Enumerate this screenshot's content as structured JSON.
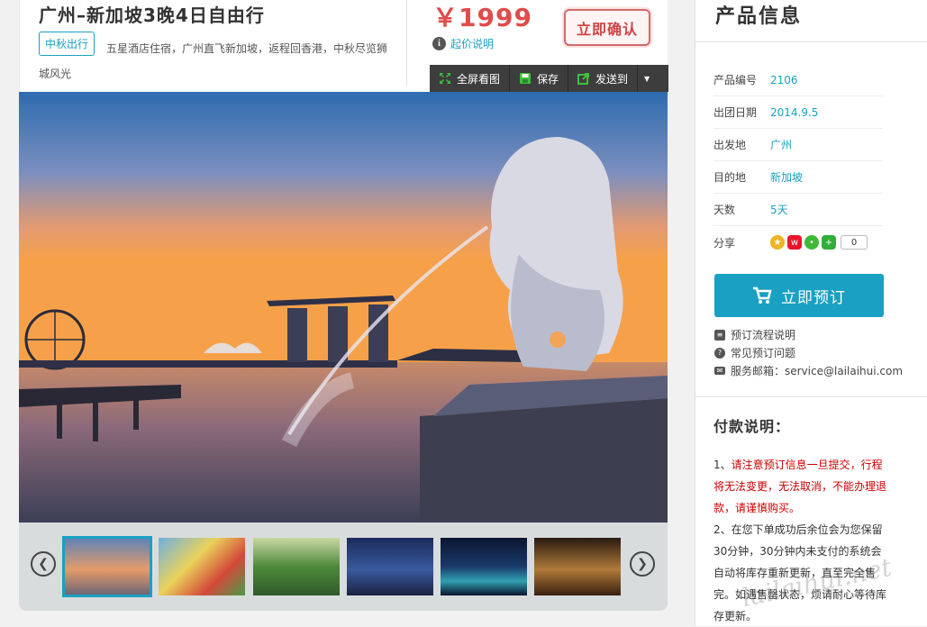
{
  "product": {
    "title": "广州–新加坡3晚4日自由行",
    "tag": "中秋出行",
    "description": "五星酒店住宿，广州直飞新加坡，返程回香港，中秋尽览狮城风光",
    "price": "￥1999",
    "price_note": "起价说明",
    "price_note_icon": "i",
    "confirm_label": "立即确认"
  },
  "toolbar": {
    "fullscreen": "全屏看图",
    "save": "保存",
    "send": "发送到"
  },
  "thumbnails": [
    {
      "name": "merlion",
      "selected": true
    },
    {
      "name": "universal-studios"
    },
    {
      "name": "jurassic-park"
    },
    {
      "name": "marina-bay-sands"
    },
    {
      "name": "gardens-by-the-bay"
    },
    {
      "name": "esplanade"
    }
  ],
  "sidebar": {
    "heading": "产品信息",
    "rows": [
      {
        "label": "产品编号",
        "value": "2106"
      },
      {
        "label": "出团日期",
        "value": "2014.9.5"
      },
      {
        "label": "出发地",
        "value": "广州"
      },
      {
        "label": "目的地",
        "value": "新加坡"
      },
      {
        "label": "天数",
        "value": "5天"
      }
    ],
    "share_label": "分享",
    "share_count": "0",
    "book_label": "立即预订",
    "links": {
      "process": "预订流程说明",
      "faq": "常见预订问题",
      "email": "服务邮箱：service@lailaihui.com"
    },
    "faq_icon": "?",
    "payment": {
      "heading": "付款说明：",
      "p1_prefix": "1、",
      "p1": "请注意预订信息一旦提交，行程将无法变更，无法取消，不能办理退款，请谨慎购买。",
      "p2": "2、在您下单成功后余位会为您保留30分钟，30分钟内未支付的系统会自动将库存重新更新，直至完全售完。如遇售罄状态，烦请耐心等待库存更新。"
    }
  },
  "watermark": "lailaihui.net",
  "colors": {
    "accent": "#1aa0c2",
    "price": "#e04b4b",
    "warning": "#cc0000"
  }
}
